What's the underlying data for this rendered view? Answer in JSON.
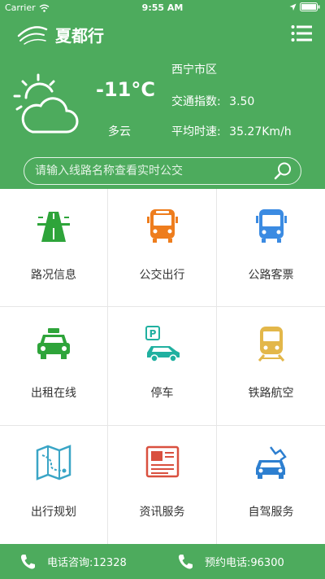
{
  "status": {
    "carrier": "Carrier",
    "time": "9:55 AM"
  },
  "header": {
    "app_title": "夏都行"
  },
  "weather": {
    "temperature": "-11°C",
    "condition": "多云",
    "district": "西宁市区",
    "traffic_label": "交通指数:",
    "traffic_value": "3.50",
    "speed_label": "平均时速:",
    "speed_value": "35.27Km/h"
  },
  "search": {
    "placeholder": "请输入线路名称查看实时公交"
  },
  "grid": {
    "items": [
      {
        "label": "路况信息",
        "icon": "road-icon"
      },
      {
        "label": "公交出行",
        "icon": "bus-icon"
      },
      {
        "label": "公路客票",
        "icon": "coach-icon"
      },
      {
        "label": "出租在线",
        "icon": "taxi-icon"
      },
      {
        "label": "停车",
        "icon": "parking-icon"
      },
      {
        "label": "铁路航空",
        "icon": "train-icon"
      },
      {
        "label": "出行规划",
        "icon": "map-icon"
      },
      {
        "label": "资讯服务",
        "icon": "newspaper-icon"
      },
      {
        "label": "自驾服务",
        "icon": "self-drive-icon"
      }
    ]
  },
  "footer": {
    "hotline_label": "电话咨询:12328",
    "booking_label": "预约电话:96300"
  },
  "colors": {
    "brand": "#4dab5d",
    "grid_line": "#e6e6e6"
  }
}
